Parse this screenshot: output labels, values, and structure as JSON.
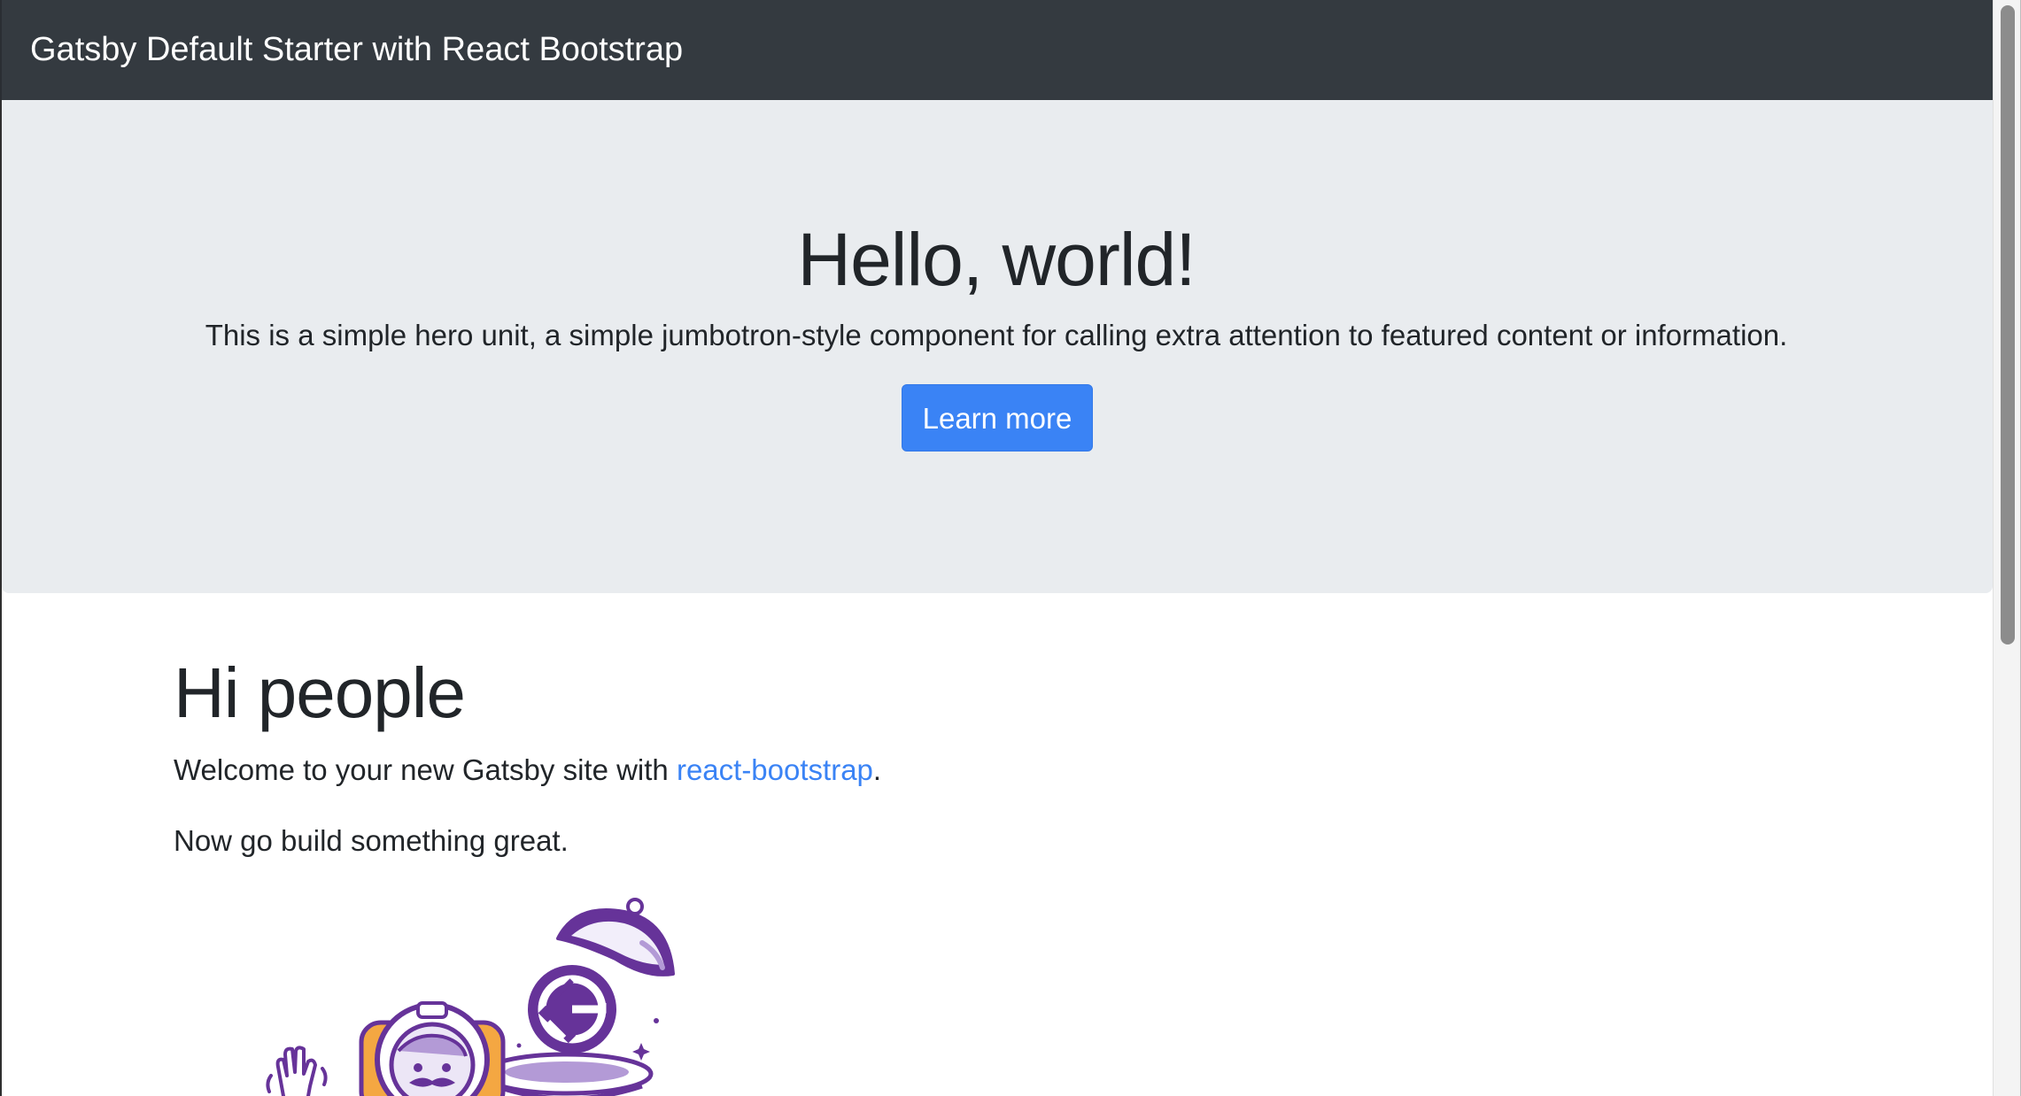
{
  "navbar": {
    "brand": "Gatsby Default Starter with React Bootstrap"
  },
  "hero": {
    "title": "Hello, world!",
    "lead": "This is a simple hero unit, a simple jumbotron-style component for calling extra attention to featured content or information.",
    "button_label": "Learn more"
  },
  "content": {
    "heading": "Hi people",
    "welcome_prefix": "Welcome to your new Gatsby site with ",
    "welcome_link": "react-bootstrap",
    "welcome_suffix": ".",
    "tagline": "Now go build something great."
  },
  "illustration": {
    "icon": "gatsby-astronaut-icon"
  },
  "colors": {
    "navbar_bg": "#343a40",
    "jumbotron_bg": "#e9ecef",
    "primary": "#3a83f5",
    "text": "#212529",
    "gatsby_purple": "#663399",
    "astronaut_orange": "#f4a742"
  }
}
